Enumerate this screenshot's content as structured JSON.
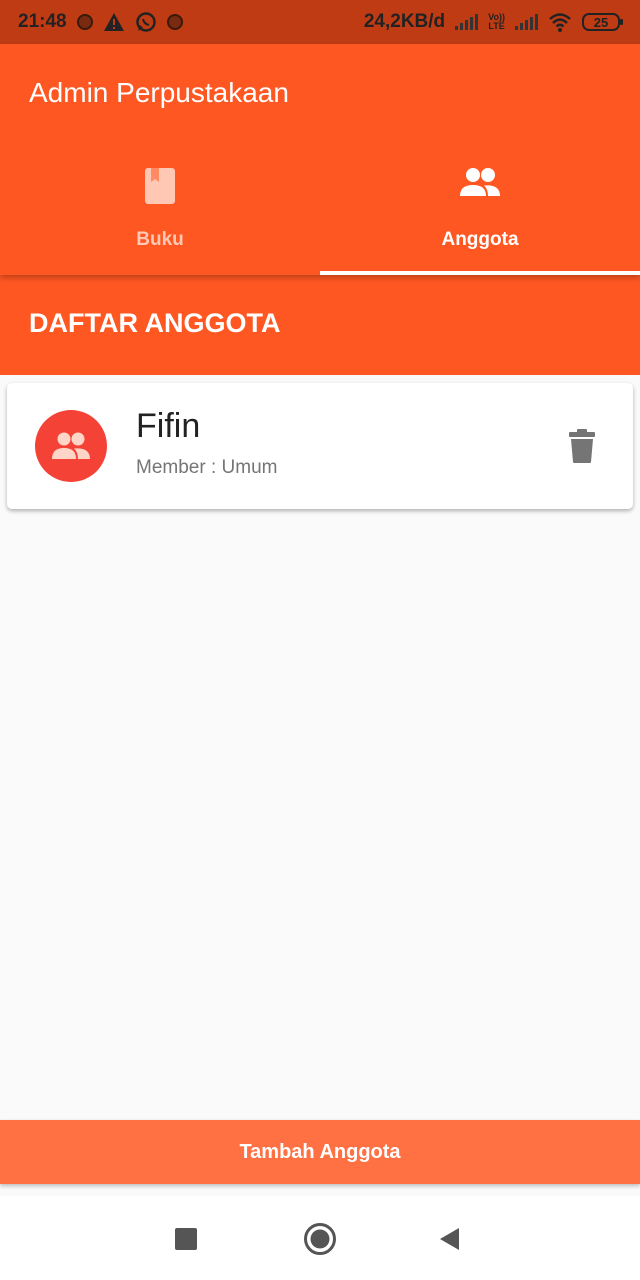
{
  "status_bar": {
    "time": "21:48",
    "network_speed": "24,2KB/d",
    "volte_top": "Vo))",
    "volte_bottom": "LTE",
    "battery": "25",
    "icons": [
      "notification-dot-icon",
      "warning-icon",
      "whatsapp-icon",
      "notification-dot-icon",
      "signal-icon",
      "signal-icon",
      "wifi-icon",
      "battery-icon"
    ]
  },
  "app": {
    "title": "Admin Perpustakaan"
  },
  "tabs": [
    {
      "label": "Buku",
      "icon": "book-icon",
      "selected": false
    },
    {
      "label": "Anggota",
      "icon": "people-icon",
      "selected": true
    }
  ],
  "section": {
    "title": "DAFTAR ANGGOTA"
  },
  "members": [
    {
      "name": "Fifin",
      "type": "Member : Umum",
      "avatar_icon": "people-icon",
      "action_icon": "delete-icon"
    }
  ],
  "actions": {
    "add_label": "Tambah Anggota"
  },
  "nav": {
    "buttons": [
      "recents-button",
      "home-button",
      "back-button"
    ]
  },
  "colors": {
    "primary": "#ff5722",
    "status_bar": "#bf3b14",
    "accent_button": "#ff7043",
    "avatar": "#f44336",
    "tab_inactive": "#ffc8b4"
  }
}
